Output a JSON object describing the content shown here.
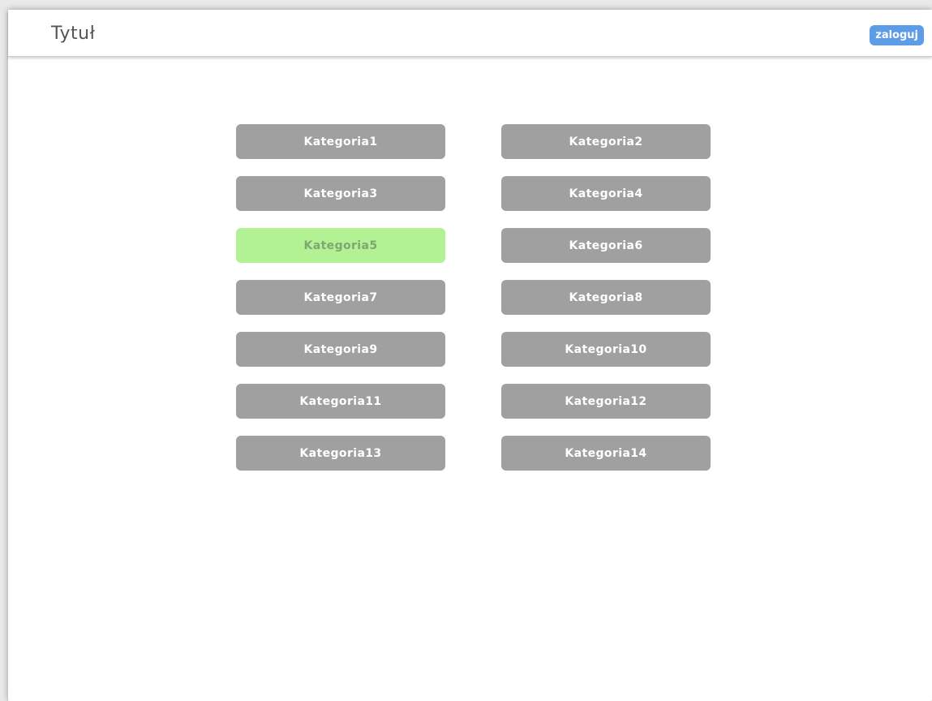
{
  "header": {
    "title": "Tytuł",
    "login_label": "zaloguj"
  },
  "colors": {
    "accent_login": "#5d9de8",
    "category_default": "#a0a0a0",
    "category_selected": "#b3f195"
  },
  "categories": [
    {
      "label": "Kategoria1",
      "selected": false
    },
    {
      "label": "Kategoria2",
      "selected": false
    },
    {
      "label": "Kategoria3",
      "selected": false
    },
    {
      "label": "Kategoria4",
      "selected": false
    },
    {
      "label": "Kategoria5",
      "selected": true
    },
    {
      "label": "Kategoria6",
      "selected": false
    },
    {
      "label": "Kategoria7",
      "selected": false
    },
    {
      "label": "Kategoria8",
      "selected": false
    },
    {
      "label": "Kategoria9",
      "selected": false
    },
    {
      "label": "Kategoria10",
      "selected": false
    },
    {
      "label": "Kategoria11",
      "selected": false
    },
    {
      "label": "Kategoria12",
      "selected": false
    },
    {
      "label": "Kategoria13",
      "selected": false
    },
    {
      "label": "Kategoria14",
      "selected": false
    }
  ]
}
